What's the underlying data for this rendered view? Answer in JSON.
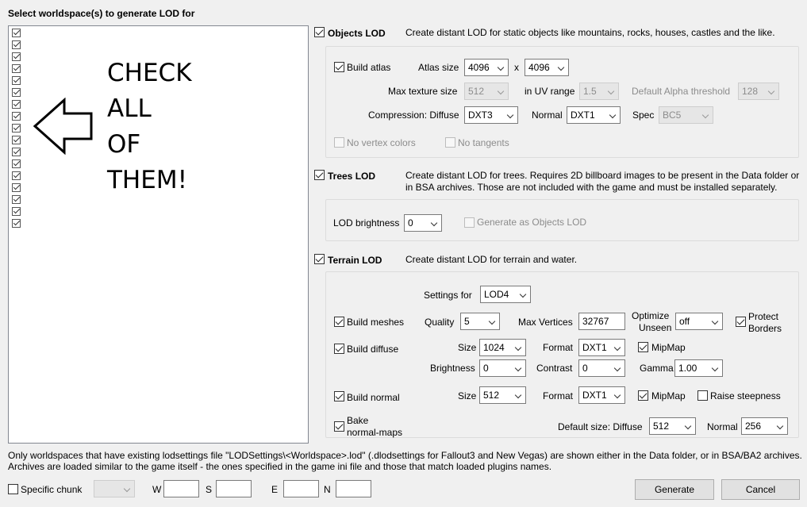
{
  "header": {
    "title": "Select worldspace(s) to generate LOD for"
  },
  "worldspace_list": {
    "item_count": 17,
    "annotation": [
      "CHECK",
      "ALL",
      "OF",
      "THEM!"
    ]
  },
  "objects_lod": {
    "label": "Objects LOD",
    "description": "Create distant LOD for static objects like mountains, rocks, houses, castles and the like.",
    "build_atlas": "Build atlas",
    "atlas_size_label": "Atlas size",
    "atlas_w": "4096",
    "x": "x",
    "atlas_h": "4096",
    "max_texture_label": "Max texture size",
    "max_texture": "512",
    "uv_range_label": "in UV range",
    "uv_range": "1.5",
    "alpha_label": "Default Alpha threshold",
    "alpha": "128",
    "compression_label": "Compression: Diffuse",
    "diffuse": "DXT3",
    "normal_label": "Normal",
    "normal": "DXT1",
    "spec_label": "Spec",
    "spec": "BC5",
    "no_vertex_colors": "No vertex colors",
    "no_tangents": "No tangents"
  },
  "trees_lod": {
    "label": "Trees LOD",
    "description_1": "Create distant LOD for trees. Requires 2D billboard images to be present in the Data folder or",
    "description_2": "in BSA archives. Those are not included with the game and must be installed separately.",
    "brightness_label": "LOD brightness",
    "brightness": "0",
    "generate_as_objects": "Generate as Objects LOD"
  },
  "terrain_lod": {
    "label": "Terrain LOD",
    "description": "Create distant LOD for terrain and water.",
    "settings_for_label": "Settings for",
    "settings_for": "LOD4",
    "build_meshes": "Build meshes",
    "quality_label": "Quality",
    "quality": "5",
    "max_vertices_label": "Max Vertices",
    "max_vertices": "32767",
    "optimize_label_1": "Optimize",
    "optimize_label_2": "Unseen",
    "optimize": "off",
    "protect_1": "Protect",
    "protect_2": "Borders",
    "build_diffuse": "Build diffuse",
    "diffuse_size_label": "Size",
    "diffuse_size": "1024",
    "diffuse_format_label": "Format",
    "diffuse_format": "DXT1",
    "diffuse_mipmap": "MipMap",
    "brightness_label": "Brightness",
    "brightness": "0",
    "contrast_label": "Contrast",
    "contrast": "0",
    "gamma_label": "Gamma",
    "gamma": "1.00",
    "build_normal": "Build normal",
    "normal_size_label": "Size",
    "normal_size": "512",
    "normal_format_label": "Format",
    "normal_format": "DXT1",
    "normal_mipmap": "MipMap",
    "raise_steepness": "Raise steepness",
    "bake_1": "Bake",
    "bake_2": "normal-maps",
    "default_size_label": "Default size: Diffuse",
    "default_diffuse": "512",
    "default_normal_label": "Normal",
    "default_normal": "256"
  },
  "footer": {
    "info_1": "Only worldspaces that have existing lodsettings file \"LODSettings\\<Worldspace>.lod\" (.dlodsettings for Fallout3 and New Vegas) are shown either in the Data folder, or in BSA/BA2 archives.",
    "info_2": "Archives are loaded similar to the game itself - the ones specified in the game ini file and those that match loaded plugins names.",
    "specific_chunk": "Specific chunk",
    "chunk_select": "",
    "w": "W",
    "s": "S",
    "e": "E",
    "n": "N",
    "generate": "Generate",
    "cancel": "Cancel"
  }
}
